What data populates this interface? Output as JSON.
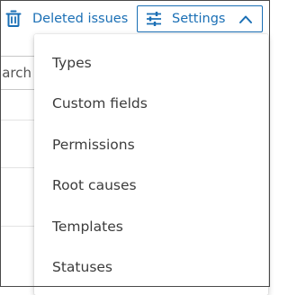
{
  "toolbar": {
    "deleted_issues_label": "Deleted issues",
    "settings_label": "Settings",
    "accent_color": "#1a6fb5"
  },
  "search": {
    "partial_value": "arch"
  },
  "settings_menu": {
    "items": [
      {
        "label": "Types"
      },
      {
        "label": "Custom fields"
      },
      {
        "label": "Permissions"
      },
      {
        "label": "Root causes"
      },
      {
        "label": "Templates"
      },
      {
        "label": "Statuses"
      }
    ]
  },
  "icons": {
    "deleted": "trash-icon",
    "settings": "sliders-icon",
    "settings_toggle": "chevron-up-icon"
  }
}
